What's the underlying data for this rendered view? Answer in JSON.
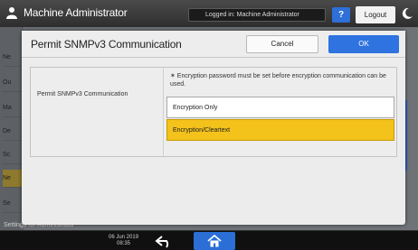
{
  "topbar": {
    "title": "Machine Administrator",
    "login_status": "Logged in: Machine Administrator",
    "help_label": "?",
    "logout_label": "Logout"
  },
  "background": {
    "side_items": [
      "Ne",
      "Ou",
      "Ma",
      "De",
      "Sc",
      "Ne",
      "Se"
    ],
    "bottom_label": "Settings for Administrator"
  },
  "dialog": {
    "title": "Permit SNMPv3 Communication",
    "cancel_label": "Cancel",
    "ok_label": "OK",
    "setting_label": "Permit SNMPv3 Communication",
    "note": "✶ Encryption password must be set before encryption communication can be used.",
    "options": [
      {
        "label": "Encryption Only",
        "selected": false
      },
      {
        "label": "Encryption/Cleartext",
        "selected": true
      }
    ]
  },
  "bottombar": {
    "date": "06 Jun 2019",
    "time": "08:35"
  },
  "colors": {
    "accent_blue": "#2e73e0",
    "selected_yellow": "#f3c21b"
  }
}
